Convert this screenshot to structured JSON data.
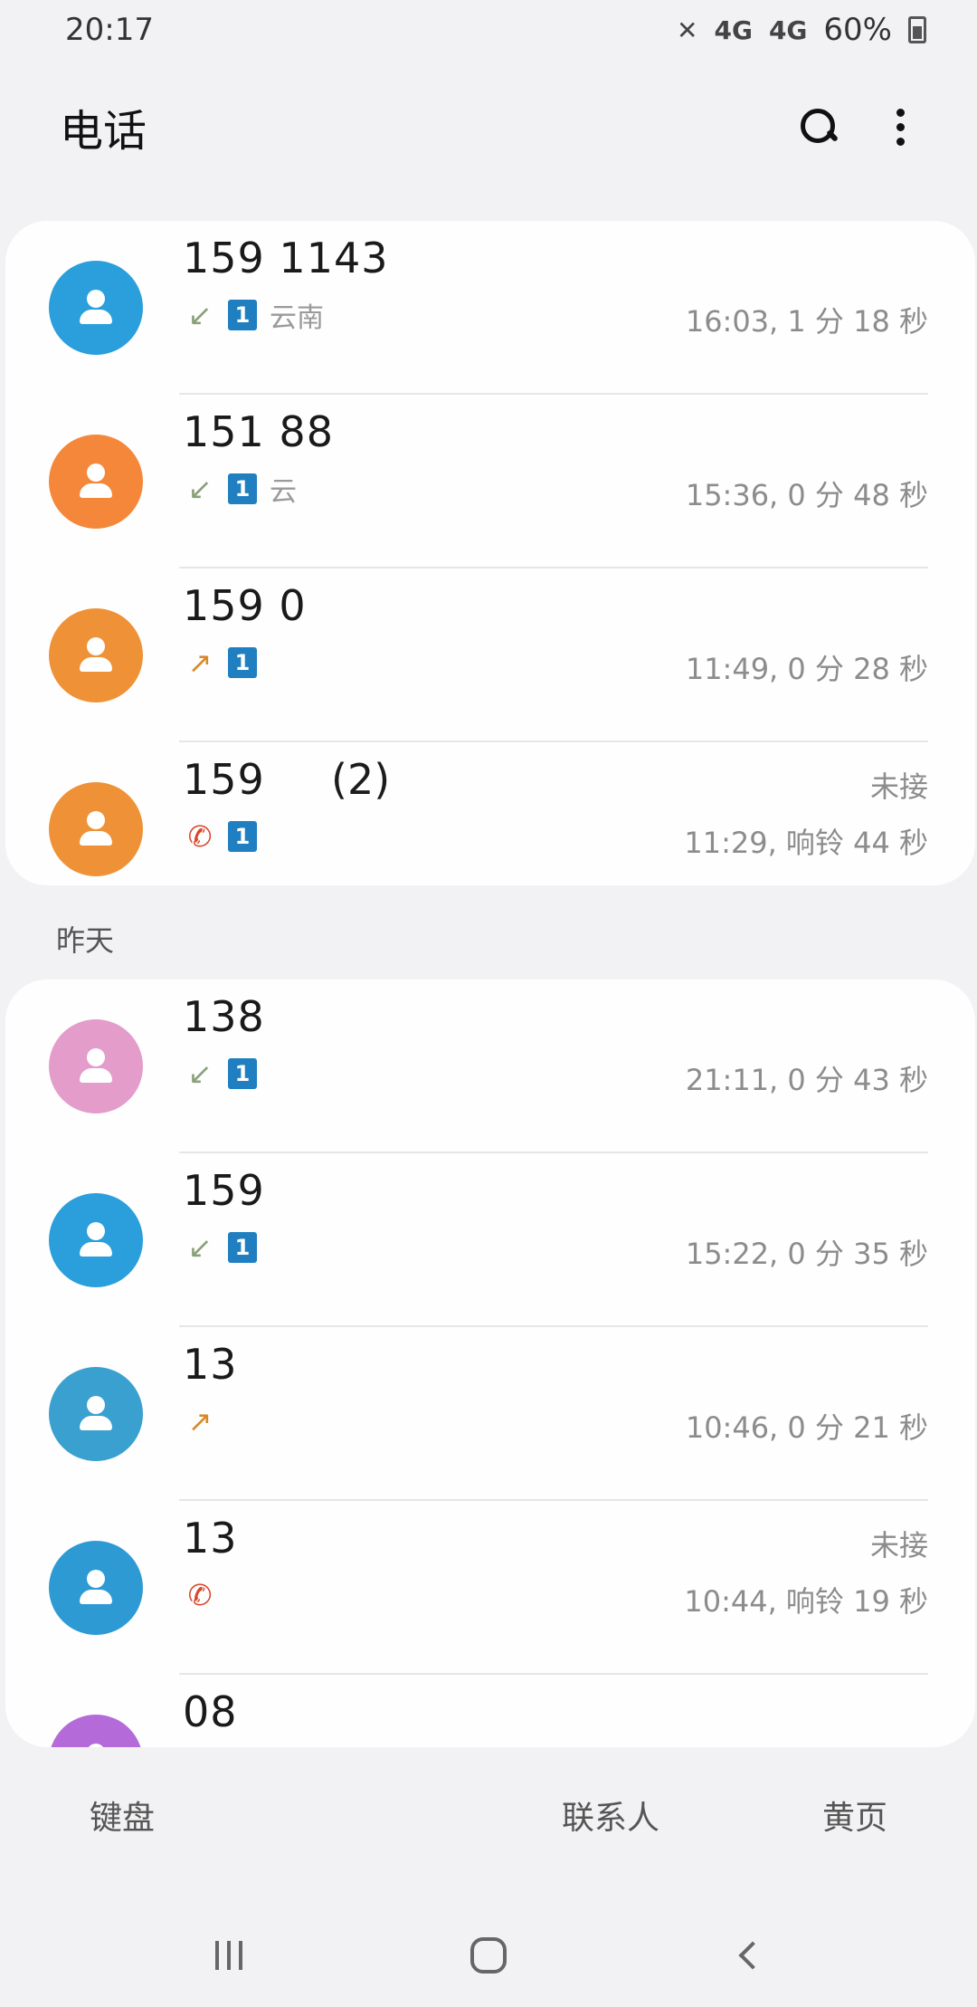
{
  "status_bar": {
    "time": "20:17",
    "network1": "4G",
    "network2": "4G",
    "battery": "60%"
  },
  "header": {
    "title": "电话",
    "search_icon": "search-icon",
    "more_icon": "more-vert-icon"
  },
  "colors": {
    "blue": "#2a9fdc",
    "orange": "#f28d3c",
    "pink": "#e49ccb",
    "teal": "#3aa0cf",
    "purple": "#b46ad8",
    "sim": "#1f7fc0",
    "missed": "#d9472b"
  },
  "today": [
    {
      "number": "159 1143",
      "type": "incoming",
      "sim": "1",
      "location": "云南",
      "time": "16:03, 1 分 18 秒",
      "status": "",
      "avatar_color": "#2a9fdc"
    },
    {
      "number": "151 88",
      "type": "incoming",
      "sim": "1",
      "location": "云",
      "time": "15:36, 0 分 48 秒",
      "status": "",
      "avatar_color": "#f4873a"
    },
    {
      "number": "159 0",
      "type": "outgoing",
      "sim": "1",
      "location": "",
      "time": "11:49, 0 分 28 秒",
      "status": "",
      "avatar_color": "#ef9237"
    },
    {
      "number": "159",
      "count": "(2)",
      "type": "missed",
      "sim": "1",
      "location": "",
      "time": "11:29, 响铃 44 秒",
      "status": "未接",
      "avatar_color": "#ef9237"
    }
  ],
  "yesterday_label": "昨天",
  "yesterday": [
    {
      "number": "138",
      "type": "incoming",
      "sim": "1",
      "location": "",
      "time": "21:11, 0 分 43 秒",
      "status": "",
      "avatar_color": "#e49ccb"
    },
    {
      "number": "159",
      "type": "incoming",
      "sim": "1",
      "location": "",
      "time": "15:22, 0 分 35 秒",
      "status": "",
      "avatar_color": "#2a9fdc"
    },
    {
      "number": "13",
      "type": "outgoing",
      "sim": "",
      "location": "",
      "time": "10:46, 0 分 21 秒",
      "status": "",
      "avatar_color": "#3aa0cf"
    },
    {
      "number": "13",
      "type": "missed",
      "sim": "",
      "location": "",
      "time": "10:44, 响铃 19 秒",
      "status": "未接",
      "avatar_color": "#2e9ad4"
    },
    {
      "number": "08",
      "type": "",
      "sim": "",
      "location": "",
      "time": "",
      "status": "",
      "avatar_color": "#b46ad8"
    }
  ],
  "tabs": [
    "键盘",
    "",
    "联系人",
    "黄页"
  ],
  "nav": {
    "recents": "recents-icon",
    "home": "home-icon",
    "back": "back-icon"
  }
}
